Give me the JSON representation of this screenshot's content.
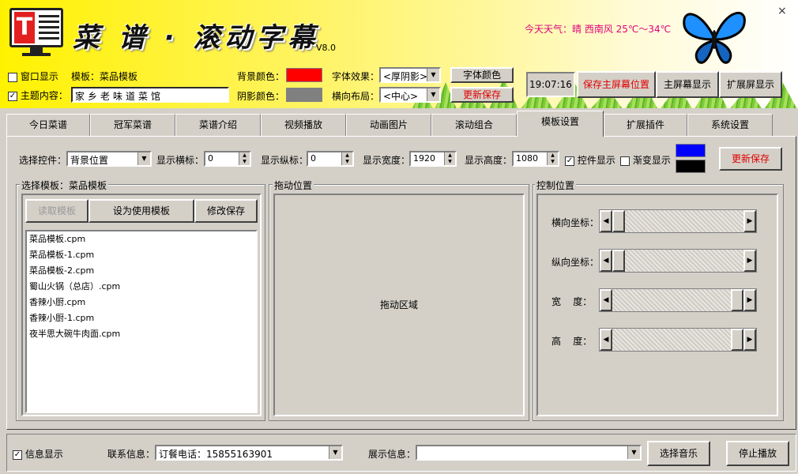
{
  "header": {
    "title": "菜 谱 · 滚动字幕",
    "version": "V8.0",
    "weather": "今天天气：晴 西南风 25℃～34℃",
    "close": "×",
    "logo_letter": "T"
  },
  "top_controls": {
    "window_display_label": "窗口显示",
    "window_display_checked": false,
    "template_label": "模板：菜品模板",
    "subject_label": "主题内容：",
    "subject_checked": true,
    "subject_value": "家乡老味道菜馆",
    "bg_color_label": "背景颜色：",
    "bg_color": "#ff0000",
    "shadow_color_label": "阴影颜色：",
    "shadow_color": "#808080",
    "font_effect_label": "字体效果：",
    "font_effect_value": "<厚阴影>",
    "layout_label": "横向布局：",
    "layout_value": "<中心>",
    "font_color_btn": "字体颜色",
    "update_save_btn": "更新保存",
    "time": "19:07:16",
    "save_main_pos_btn": "保存主屏幕位置",
    "main_display_btn": "主屏幕显示",
    "ext_display_btn": "扩展屏显示"
  },
  "tabs": [
    "今日菜谱",
    "冠军菜谱",
    "菜谱介绍",
    "视频播放",
    "动画图片",
    "滚动组合",
    "模板设置",
    "扩展插件",
    "系统设置"
  ],
  "active_tab": "模板设置",
  "panel": {
    "select_control_label": "选择控件：",
    "select_control_value": "背景位置",
    "x_label": "显示横标：",
    "x_value": "0",
    "y_label": "显示纵标：",
    "y_value": "0",
    "w_label": "显示宽度：",
    "w_value": "1920",
    "h_label": "显示高度：",
    "h_value": "1080",
    "ctrl_display_label": "控件显示",
    "ctrl_display_checked": true,
    "gradient_label": "渐变显示",
    "gradient_checked": false,
    "color1": "#0000ff",
    "color2": "#000000",
    "update_save_btn": "更新保存",
    "template_group_title": "选择模板：菜品模板",
    "read_template_btn": "读取模板",
    "set_template_btn": "设为使用模板",
    "modify_save_btn": "修改保存",
    "templates": [
      "菜品模板.cpm",
      "菜品模板-1.cpm",
      "菜品模板-2.cpm",
      "蜀山火锅（总店）.cpm",
      "香辣小厨.cpm",
      "香辣小厨-1.cpm",
      "夜半思大碗牛肉面.cpm"
    ],
    "drag_group_title": "拖动位置",
    "drag_area_label": "拖动区域",
    "control_group_title": "控制位置",
    "sliders": [
      {
        "label": "横向坐标：",
        "value": 0.0
      },
      {
        "label": "纵向坐标：",
        "value": 0.0
      },
      {
        "label": "宽    度：",
        "value": 1.0
      },
      {
        "label": "高    度：",
        "value": 1.0
      }
    ]
  },
  "bottom": {
    "info_display_label": "信息显示",
    "info_display_checked": true,
    "contact_label": "联系信息：",
    "contact_value": "订餐电话：15855163901",
    "show_info_label": "展示信息：",
    "show_info_value": "",
    "select_music_btn": "选择音乐",
    "stop_play_btn": "停止播放"
  }
}
